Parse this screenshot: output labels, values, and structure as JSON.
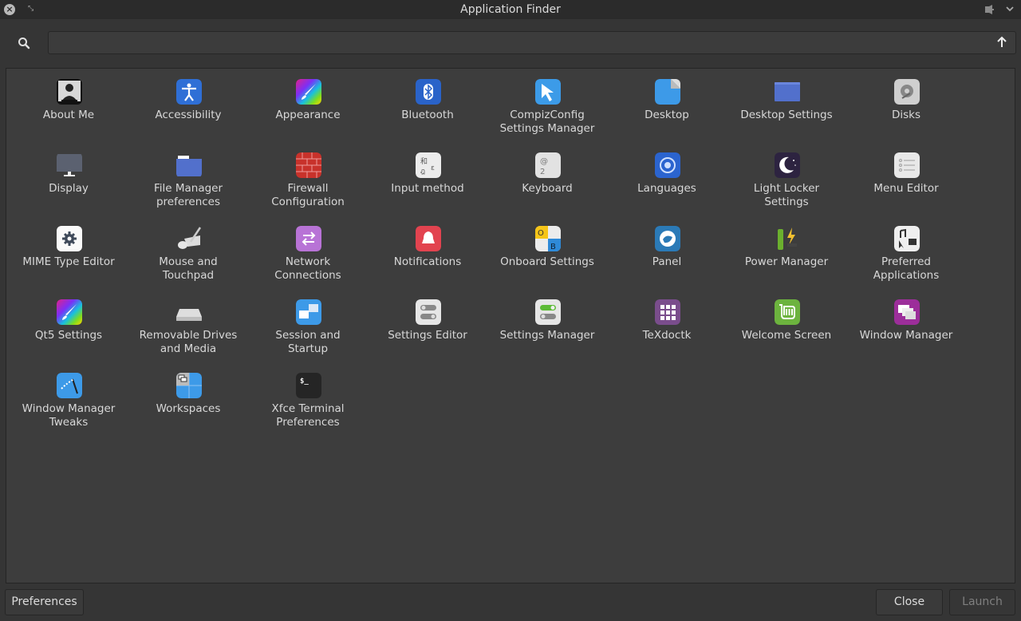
{
  "window": {
    "title": "Application Finder"
  },
  "search": {
    "value": "",
    "placeholder": ""
  },
  "apps": [
    {
      "label": "About Me",
      "icon": "about-me-icon"
    },
    {
      "label": "Accessibility",
      "icon": "accessibility-icon"
    },
    {
      "label": "Appearance",
      "icon": "appearance-icon"
    },
    {
      "label": "Bluetooth",
      "icon": "bluetooth-icon"
    },
    {
      "label": "CompizConfig\nSettings Manager",
      "icon": "compizconfig-icon"
    },
    {
      "label": "Desktop",
      "icon": "desktop-icon"
    },
    {
      "label": "Desktop Settings",
      "icon": "desktop-settings-icon"
    },
    {
      "label": "Disks",
      "icon": "disks-icon"
    },
    {
      "label": "Display",
      "icon": "display-icon"
    },
    {
      "label": "File Manager\npreferences",
      "icon": "file-manager-icon"
    },
    {
      "label": "Firewall\nConfiguration",
      "icon": "firewall-icon"
    },
    {
      "label": "Input method",
      "icon": "input-method-icon"
    },
    {
      "label": "Keyboard",
      "icon": "keyboard-icon"
    },
    {
      "label": "Languages",
      "icon": "languages-icon"
    },
    {
      "label": "Light Locker\nSettings",
      "icon": "light-locker-icon"
    },
    {
      "label": "Menu Editor",
      "icon": "menu-editor-icon"
    },
    {
      "label": "MIME Type Editor",
      "icon": "mime-type-editor-icon"
    },
    {
      "label": "Mouse and\nTouchpad",
      "icon": "mouse-touchpad-icon"
    },
    {
      "label": "Network\nConnections",
      "icon": "network-connections-icon"
    },
    {
      "label": "Notifications",
      "icon": "notifications-icon"
    },
    {
      "label": "Onboard Settings",
      "icon": "onboard-settings-icon"
    },
    {
      "label": "Panel",
      "icon": "panel-icon"
    },
    {
      "label": "Power Manager",
      "icon": "power-manager-icon"
    },
    {
      "label": "Preferred\nApplications",
      "icon": "preferred-applications-icon"
    },
    {
      "label": "Qt5 Settings",
      "icon": "qt5-settings-icon"
    },
    {
      "label": "Removable Drives\nand Media",
      "icon": "removable-drives-icon"
    },
    {
      "label": "Session and\nStartup",
      "icon": "session-startup-icon"
    },
    {
      "label": "Settings Editor",
      "icon": "settings-editor-icon"
    },
    {
      "label": "Settings Manager",
      "icon": "settings-manager-icon"
    },
    {
      "label": "TeXdoctk",
      "icon": "texdoctk-icon"
    },
    {
      "label": "Welcome Screen",
      "icon": "welcome-screen-icon"
    },
    {
      "label": "Window Manager",
      "icon": "window-manager-icon"
    },
    {
      "label": "Window Manager\nTweaks",
      "icon": "window-manager-tweaks-icon"
    },
    {
      "label": "Workspaces",
      "icon": "workspaces-icon"
    },
    {
      "label": "Xfce Terminal\nPreferences",
      "icon": "xfce-terminal-icon"
    }
  ],
  "buttons": {
    "preferences": "Preferences",
    "close": "Close",
    "launch": "Launch"
  }
}
